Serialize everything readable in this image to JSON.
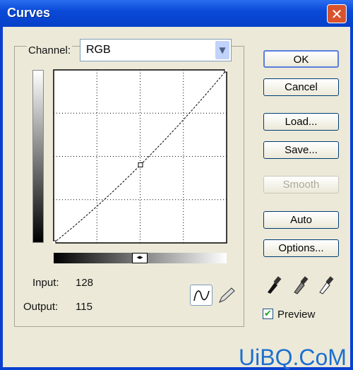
{
  "window": {
    "title": "Curves",
    "close_icon": "close-icon"
  },
  "channel": {
    "label": "Channel:",
    "value": "RGB"
  },
  "buttons": {
    "ok": "OK",
    "cancel": "Cancel",
    "load": "Load...",
    "save": "Save...",
    "smooth": "Smooth",
    "auto": "Auto",
    "options": "Options..."
  },
  "readout": {
    "input_label": "Input:",
    "input_value": "128",
    "output_label": "Output:",
    "output_value": "115"
  },
  "curve": {
    "points": [
      [
        0,
        0
      ],
      [
        128,
        115
      ],
      [
        255,
        255
      ]
    ],
    "range": [
      0,
      255
    ]
  },
  "tools": {
    "curve": "curve-tool-icon",
    "pencil": "pencil-icon",
    "eyedroppers": [
      "black-eyedropper-icon",
      "gray-eyedropper-icon",
      "white-eyedropper-icon"
    ]
  },
  "preview": {
    "label": "Preview",
    "checked": true
  },
  "watermark": "UiBQ.CoM"
}
